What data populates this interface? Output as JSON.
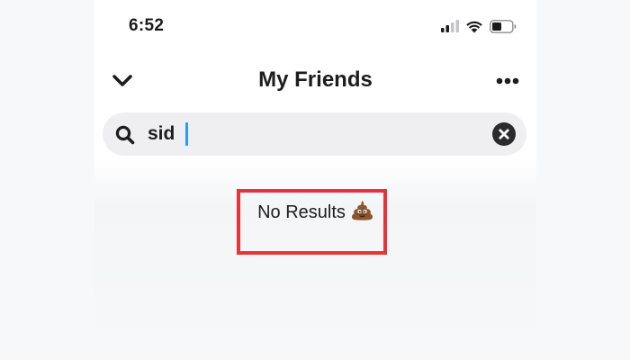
{
  "status_bar": {
    "time": "6:52",
    "icons": [
      "signal-icon",
      "wifi-icon",
      "battery-icon"
    ]
  },
  "header": {
    "title": "My Friends",
    "back_icon": "chevron-down-icon",
    "more_icon": "more-horizontal-icon"
  },
  "search": {
    "value": "sid",
    "icon": "search-icon",
    "clear_icon": "clear-icon"
  },
  "results": {
    "empty_text": "No Results",
    "empty_emoji": "pile-of-poo-icon"
  },
  "colors": {
    "text": "#1d1d1f",
    "search_bg": "#efeff1",
    "caret": "#2d9bf0",
    "highlight": "#e8333b"
  }
}
